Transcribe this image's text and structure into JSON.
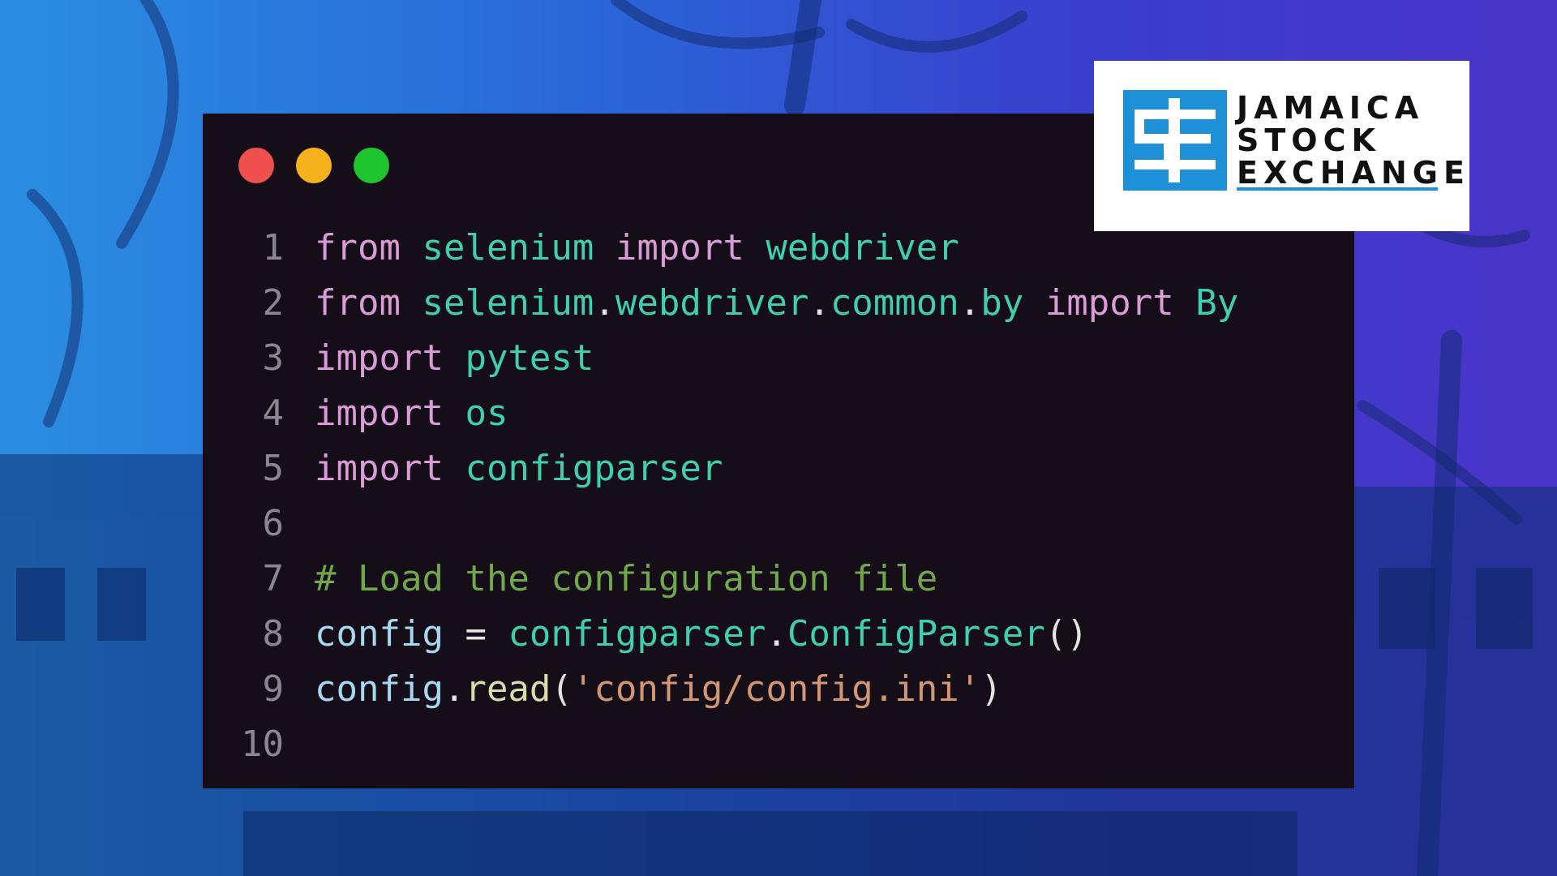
{
  "colors": {
    "window_bg": "#150d17",
    "keyword": "#d99cd6",
    "module": "#3fcfae",
    "identifier": "#a7d8f2",
    "function": "#dcdcaa",
    "string": "#d29673",
    "comment": "#6fa74a",
    "line_number": "#8b8791",
    "logo_blue": "#1e90d8"
  },
  "window_controls": [
    "close-dot",
    "minimize-dot",
    "maximize-dot"
  ],
  "code": {
    "lines": [
      {
        "n": "1",
        "tokens": [
          {
            "t": "from",
            "c": "kw"
          },
          {
            "t": " ",
            "c": "pn"
          },
          {
            "t": "selenium",
            "c": "mod"
          },
          {
            "t": " ",
            "c": "pn"
          },
          {
            "t": "import",
            "c": "kw"
          },
          {
            "t": " ",
            "c": "pn"
          },
          {
            "t": "webdriver",
            "c": "mod"
          }
        ]
      },
      {
        "n": "2",
        "tokens": [
          {
            "t": "from",
            "c": "kw"
          },
          {
            "t": " ",
            "c": "pn"
          },
          {
            "t": "selenium",
            "c": "mod"
          },
          {
            "t": ".",
            "c": "pn"
          },
          {
            "t": "webdriver",
            "c": "mod"
          },
          {
            "t": ".",
            "c": "pn"
          },
          {
            "t": "common",
            "c": "mod"
          },
          {
            "t": ".",
            "c": "pn"
          },
          {
            "t": "by",
            "c": "mod"
          },
          {
            "t": " ",
            "c": "pn"
          },
          {
            "t": "import",
            "c": "kw"
          },
          {
            "t": " ",
            "c": "pn"
          },
          {
            "t": "By",
            "c": "mod"
          }
        ]
      },
      {
        "n": "3",
        "tokens": [
          {
            "t": "import",
            "c": "kw"
          },
          {
            "t": " ",
            "c": "pn"
          },
          {
            "t": "pytest",
            "c": "mod"
          }
        ]
      },
      {
        "n": "4",
        "tokens": [
          {
            "t": "import",
            "c": "kw"
          },
          {
            "t": " ",
            "c": "pn"
          },
          {
            "t": "os",
            "c": "mod"
          }
        ]
      },
      {
        "n": "5",
        "tokens": [
          {
            "t": "import",
            "c": "kw"
          },
          {
            "t": " ",
            "c": "pn"
          },
          {
            "t": "configparser",
            "c": "mod"
          }
        ]
      },
      {
        "n": "6",
        "tokens": []
      },
      {
        "n": "7",
        "tokens": [
          {
            "t": "# Load the configuration file",
            "c": "cm"
          }
        ]
      },
      {
        "n": "8",
        "tokens": [
          {
            "t": "config",
            "c": "id"
          },
          {
            "t": " = ",
            "c": "pn"
          },
          {
            "t": "configparser",
            "c": "mod"
          },
          {
            "t": ".",
            "c": "pn"
          },
          {
            "t": "ConfigParser",
            "c": "mod"
          },
          {
            "t": "()",
            "c": "pn"
          }
        ]
      },
      {
        "n": "9",
        "tokens": [
          {
            "t": "config",
            "c": "id"
          },
          {
            "t": ".",
            "c": "pn"
          },
          {
            "t": "read",
            "c": "fn"
          },
          {
            "t": "(",
            "c": "pn"
          },
          {
            "t": "'config/config.ini'",
            "c": "str"
          },
          {
            "t": ")",
            "c": "pn"
          }
        ]
      },
      {
        "n": "10",
        "tokens": []
      }
    ]
  },
  "logo": {
    "line1": "JAMAICA",
    "line2": "STOCK",
    "line3": "EXCHANGE"
  }
}
